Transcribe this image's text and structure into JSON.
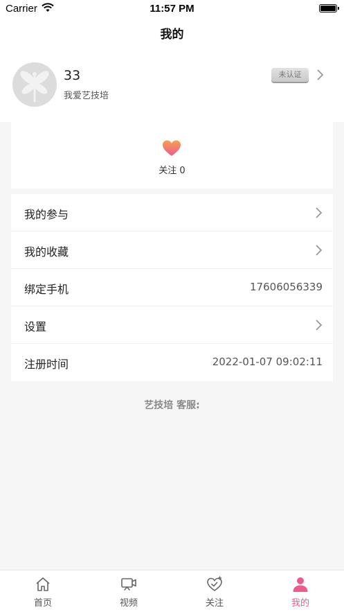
{
  "status_bar": {
    "carrier": "Carrier",
    "time": "11:57 PM"
  },
  "page_title": "我的",
  "profile": {
    "name": "33",
    "subtitle": "我爱艺技培",
    "badge": "未认证"
  },
  "follow": {
    "label": "关注 0"
  },
  "menu": [
    {
      "label": "我的参与",
      "value": ""
    },
    {
      "label": "我的收藏",
      "value": ""
    },
    {
      "label": "绑定手机",
      "value": "17606056339"
    },
    {
      "label": "设置",
      "value": ""
    },
    {
      "label": "注册时间",
      "value": "2022-01-07 09:02:11"
    }
  ],
  "service_text": "艺技培 客服:",
  "tabs": [
    {
      "label": "首页",
      "icon": "home-icon"
    },
    {
      "label": "视频",
      "icon": "video-icon"
    },
    {
      "label": "关注",
      "icon": "heart-follow-icon"
    },
    {
      "label": "我的",
      "icon": "person-icon",
      "active": true
    }
  ],
  "colors": {
    "accent": "#ee5a8a",
    "heart_top": "#f7a14e",
    "heart_bottom": "#ec5a93",
    "background": "#f6f6f6"
  }
}
